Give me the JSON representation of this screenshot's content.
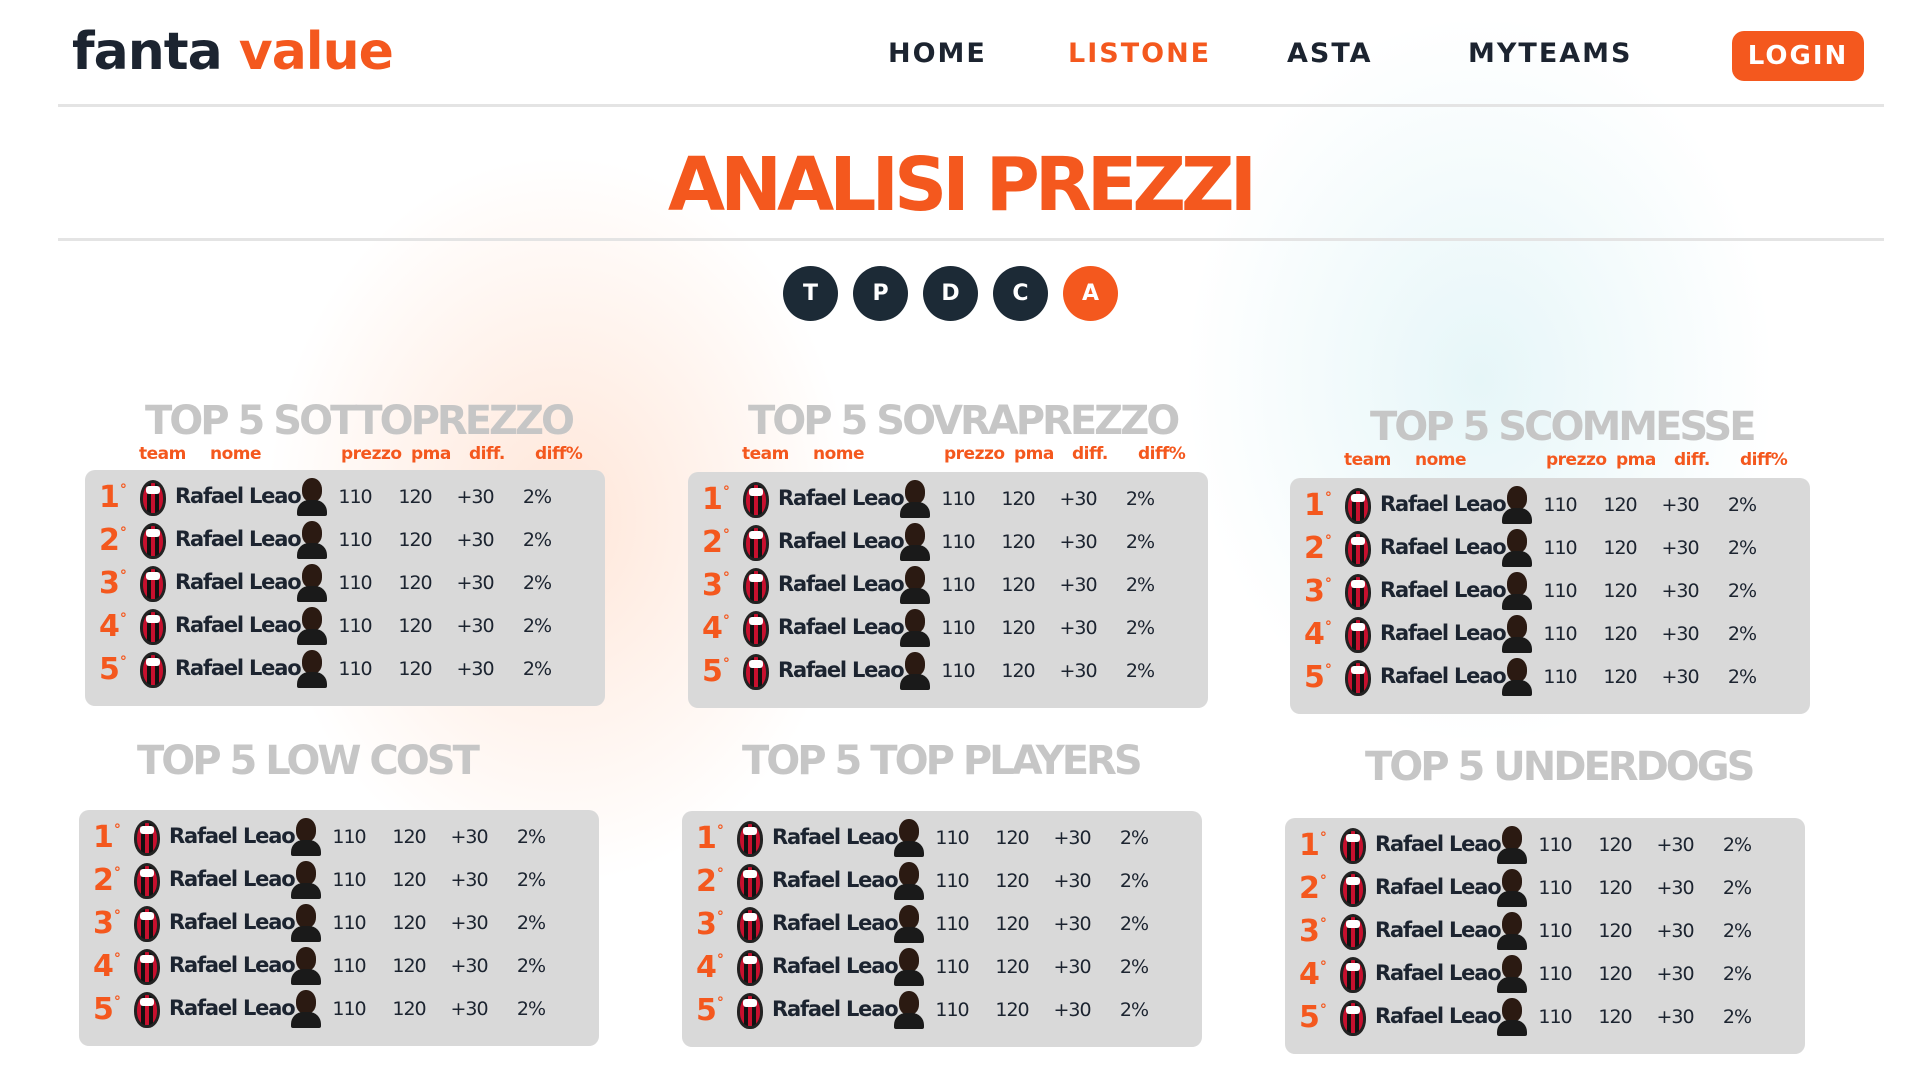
{
  "brand": {
    "part1": "fanta",
    "part2": "value"
  },
  "nav": {
    "items": [
      {
        "label": "HOME"
      },
      {
        "label": "LISTONE"
      },
      {
        "label": "ASTA"
      },
      {
        "label": "MYTEAMS"
      }
    ],
    "active": "LISTONE",
    "login_label": "LOGIN"
  },
  "page_title": "ANALISI PREZZI",
  "filters": [
    "T",
    "P",
    "D",
    "C",
    "A"
  ],
  "active_filter": "A",
  "columns": [
    "team",
    "nome",
    "prezzo",
    "pma",
    "diff.",
    "diff%"
  ],
  "accent_color": "#f4581e",
  "dark_color": "#1c2a36",
  "rank_suffix": "°",
  "panels": [
    {
      "title": "TOP 5 SOTTOPREZZO",
      "show_columns": true,
      "rows": [
        {
          "rank": "1",
          "team_icon": "ac-milan-crest-icon",
          "name": "Rafael Leao",
          "prezzo": "110",
          "pma": "120",
          "diff": "+30",
          "diffp": "2%"
        },
        {
          "rank": "2",
          "team_icon": "ac-milan-crest-icon",
          "name": "Rafael Leao",
          "prezzo": "110",
          "pma": "120",
          "diff": "+30",
          "diffp": "2%"
        },
        {
          "rank": "3",
          "team_icon": "ac-milan-crest-icon",
          "name": "Rafael Leao",
          "prezzo": "110",
          "pma": "120",
          "diff": "+30",
          "diffp": "2%"
        },
        {
          "rank": "4",
          "team_icon": "ac-milan-crest-icon",
          "name": "Rafael Leao",
          "prezzo": "110",
          "pma": "120",
          "diff": "+30",
          "diffp": "2%"
        },
        {
          "rank": "5",
          "team_icon": "ac-milan-crest-icon",
          "name": "Rafael Leao",
          "prezzo": "110",
          "pma": "120",
          "diff": "+30",
          "diffp": "2%"
        }
      ]
    },
    {
      "title": "TOP 5 SOVRAPREZZO",
      "show_columns": true,
      "rows": [
        {
          "rank": "1",
          "team_icon": "ac-milan-crest-icon",
          "name": "Rafael Leao",
          "prezzo": "110",
          "pma": "120",
          "diff": "+30",
          "diffp": "2%"
        },
        {
          "rank": "2",
          "team_icon": "ac-milan-crest-icon",
          "name": "Rafael Leao",
          "prezzo": "110",
          "pma": "120",
          "diff": "+30",
          "diffp": "2%"
        },
        {
          "rank": "3",
          "team_icon": "ac-milan-crest-icon",
          "name": "Rafael Leao",
          "prezzo": "110",
          "pma": "120",
          "diff": "+30",
          "diffp": "2%"
        },
        {
          "rank": "4",
          "team_icon": "ac-milan-crest-icon",
          "name": "Rafael Leao",
          "prezzo": "110",
          "pma": "120",
          "diff": "+30",
          "diffp": "2%"
        },
        {
          "rank": "5",
          "team_icon": "ac-milan-crest-icon",
          "name": "Rafael Leao",
          "prezzo": "110",
          "pma": "120",
          "diff": "+30",
          "diffp": "2%"
        }
      ]
    },
    {
      "title": "TOP 5 SCOMMESSE",
      "show_columns": true,
      "rows": [
        {
          "rank": "1",
          "team_icon": "ac-milan-crest-icon",
          "name": "Rafael Leao",
          "prezzo": "110",
          "pma": "120",
          "diff": "+30",
          "diffp": "2%"
        },
        {
          "rank": "2",
          "team_icon": "ac-milan-crest-icon",
          "name": "Rafael Leao",
          "prezzo": "110",
          "pma": "120",
          "diff": "+30",
          "diffp": "2%"
        },
        {
          "rank": "3",
          "team_icon": "ac-milan-crest-icon",
          "name": "Rafael Leao",
          "prezzo": "110",
          "pma": "120",
          "diff": "+30",
          "diffp": "2%"
        },
        {
          "rank": "4",
          "team_icon": "ac-milan-crest-icon",
          "name": "Rafael Leao",
          "prezzo": "110",
          "pma": "120",
          "diff": "+30",
          "diffp": "2%"
        },
        {
          "rank": "5",
          "team_icon": "ac-milan-crest-icon",
          "name": "Rafael Leao",
          "prezzo": "110",
          "pma": "120",
          "diff": "+30",
          "diffp": "2%"
        }
      ]
    },
    {
      "title": "TOP 5 LOW COST",
      "show_columns": false,
      "rows": [
        {
          "rank": "1",
          "team_icon": "ac-milan-crest-icon",
          "name": "Rafael Leao",
          "prezzo": "110",
          "pma": "120",
          "diff": "+30",
          "diffp": "2%"
        },
        {
          "rank": "2",
          "team_icon": "ac-milan-crest-icon",
          "name": "Rafael Leao",
          "prezzo": "110",
          "pma": "120",
          "diff": "+30",
          "diffp": "2%"
        },
        {
          "rank": "3",
          "team_icon": "ac-milan-crest-icon",
          "name": "Rafael Leao",
          "prezzo": "110",
          "pma": "120",
          "diff": "+30",
          "diffp": "2%"
        },
        {
          "rank": "4",
          "team_icon": "ac-milan-crest-icon",
          "name": "Rafael Leao",
          "prezzo": "110",
          "pma": "120",
          "diff": "+30",
          "diffp": "2%"
        },
        {
          "rank": "5",
          "team_icon": "ac-milan-crest-icon",
          "name": "Rafael Leao",
          "prezzo": "110",
          "pma": "120",
          "diff": "+30",
          "diffp": "2%"
        }
      ]
    },
    {
      "title": "TOP 5 TOP PLAYERS",
      "show_columns": false,
      "rows": [
        {
          "rank": "1",
          "team_icon": "ac-milan-crest-icon",
          "name": "Rafael Leao",
          "prezzo": "110",
          "pma": "120",
          "diff": "+30",
          "diffp": "2%"
        },
        {
          "rank": "2",
          "team_icon": "ac-milan-crest-icon",
          "name": "Rafael Leao",
          "prezzo": "110",
          "pma": "120",
          "diff": "+30",
          "diffp": "2%"
        },
        {
          "rank": "3",
          "team_icon": "ac-milan-crest-icon",
          "name": "Rafael Leao",
          "prezzo": "110",
          "pma": "120",
          "diff": "+30",
          "diffp": "2%"
        },
        {
          "rank": "4",
          "team_icon": "ac-milan-crest-icon",
          "name": "Rafael Leao",
          "prezzo": "110",
          "pma": "120",
          "diff": "+30",
          "diffp": "2%"
        },
        {
          "rank": "5",
          "team_icon": "ac-milan-crest-icon",
          "name": "Rafael Leao",
          "prezzo": "110",
          "pma": "120",
          "diff": "+30",
          "diffp": "2%"
        }
      ]
    },
    {
      "title": "TOP 5 UNDERDOGS",
      "show_columns": false,
      "rows": [
        {
          "rank": "1",
          "team_icon": "ac-milan-crest-icon",
          "name": "Rafael Leao",
          "prezzo": "110",
          "pma": "120",
          "diff": "+30",
          "diffp": "2%"
        },
        {
          "rank": "2",
          "team_icon": "ac-milan-crest-icon",
          "name": "Rafael Leao",
          "prezzo": "110",
          "pma": "120",
          "diff": "+30",
          "diffp": "2%"
        },
        {
          "rank": "3",
          "team_icon": "ac-milan-crest-icon",
          "name": "Rafael Leao",
          "prezzo": "110",
          "pma": "120",
          "diff": "+30",
          "diffp": "2%"
        },
        {
          "rank": "4",
          "team_icon": "ac-milan-crest-icon",
          "name": "Rafael Leao",
          "prezzo": "110",
          "pma": "120",
          "diff": "+30",
          "diffp": "2%"
        },
        {
          "rank": "5",
          "team_icon": "ac-milan-crest-icon",
          "name": "Rafael Leao",
          "prezzo": "110",
          "pma": "120",
          "diff": "+30",
          "diffp": "2%"
        }
      ]
    }
  ]
}
